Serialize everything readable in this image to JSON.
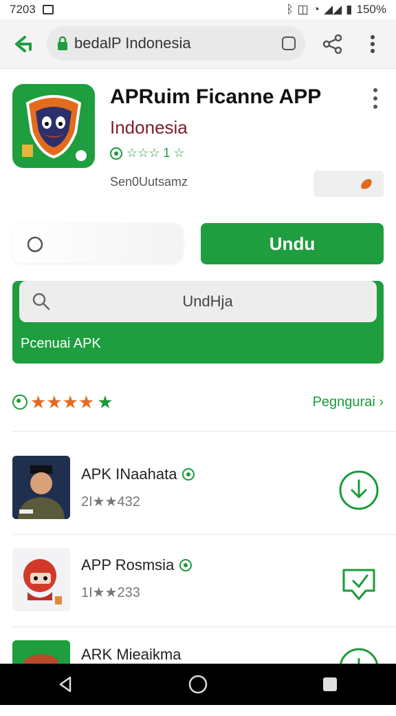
{
  "status": {
    "time": "7203",
    "battery": "150%"
  },
  "browser": {
    "url": "bedalP Indonesia",
    "back_icon": "back-arrow-icon",
    "share_icon": "share-icon",
    "menu_icon": "more-vertical-icon"
  },
  "app": {
    "title": "APRuim Ficanne APP",
    "subtitle": "Indonesia",
    "rating_text": "☆☆☆ 1 ☆",
    "developer": "Sen0Uutsamz",
    "download_label": "Undu",
    "colors": {
      "brand_green": "#1e9e3e",
      "accent_orange": "#e36b1e",
      "subtitle": "#7a1e2a"
    }
  },
  "promo": {
    "search_text": "UndHja",
    "label": "Pcenuai APK"
  },
  "ratings": {
    "stars_orange": "★★★★",
    "star_green": "★",
    "more_link": "Pegngurai ›"
  },
  "list": [
    {
      "title": "APK INaahata",
      "meta": "2I★★432"
    },
    {
      "title": "APP Rosmsia",
      "meta": "1I★★233"
    },
    {
      "title": "ARK Mieaikma",
      "meta": ""
    }
  ]
}
